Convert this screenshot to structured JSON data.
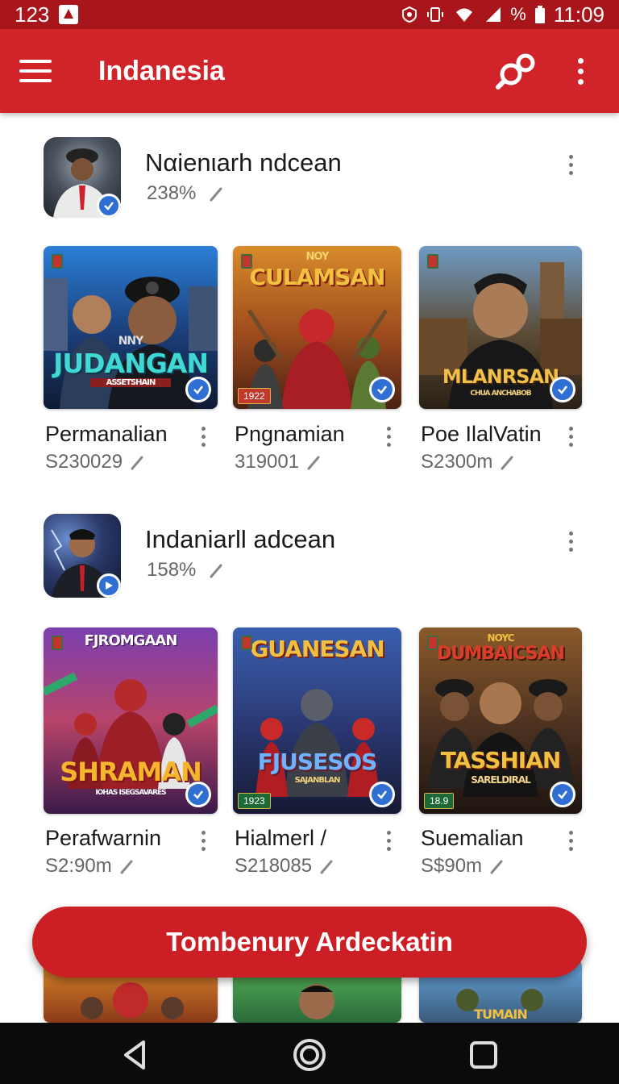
{
  "status_bar": {
    "left_text": "123",
    "battery_text": "%",
    "time": "11:09"
  },
  "app_bar": {
    "title": "Indanesia"
  },
  "sections": [
    {
      "title": "Nαienιarh ndcean",
      "meta": "238%",
      "cards": [
        {
          "name": "Permanalian",
          "meta": "S230029",
          "poster_title": "JUDANGAN",
          "poster_top": "NNY",
          "poster_sub": "ASSETSHAIN",
          "tag": ""
        },
        {
          "name": "Pngnamian",
          "meta": "319001",
          "poster_title": "CULAMSAN",
          "poster_top": "NOY",
          "poster_sub": "",
          "tag": "1922"
        },
        {
          "name": "Poe IlalVatin",
          "meta": "S2300m",
          "poster_title": "MLANRSAN",
          "poster_top": "",
          "poster_sub": "CHUA ANCHABOB",
          "tag": ""
        }
      ]
    },
    {
      "title": "Indaniarll adcean",
      "meta": "158%",
      "cards": [
        {
          "name": "Perafwarnin",
          "meta": "S2:90m",
          "poster_title": "SHRAMAN",
          "poster_top": "FJROMGAAN",
          "poster_sub": "IOHAS ISEGSAVARES",
          "tag": ""
        },
        {
          "name": "Hialmerl /",
          "meta": "S218085",
          "poster_title": "FJUSESOS",
          "poster_top": "GUANESAN",
          "poster_sub": "SAJANBLAN",
          "tag": "1923"
        },
        {
          "name": "Suemalian",
          "meta": "S$90m",
          "poster_title": "TASSHIAN",
          "poster_top": "DUMBAICSAN",
          "poster_sub": "SARELDIRAL",
          "tag": "18.9"
        }
      ]
    }
  ],
  "peek_posters": [
    "",
    "",
    "TUMAIN"
  ],
  "cta": {
    "label": "Tombenury Ardeckatin"
  },
  "colors": {
    "primary": "#d1232a",
    "status_bar": "#a8151a",
    "badge_blue": "#2f6fd3"
  },
  "icons": [
    "menu-icon",
    "search-icon",
    "more-vertical-icon",
    "verified-check-icon",
    "play-icon",
    "pencil-icon",
    "back-icon",
    "home-icon",
    "recents-icon"
  ]
}
